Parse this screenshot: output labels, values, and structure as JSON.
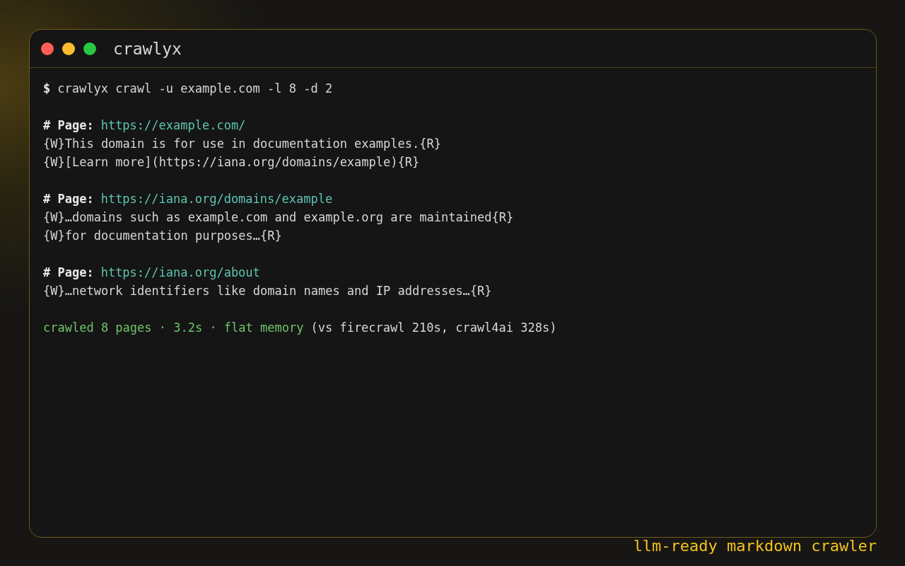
{
  "window": {
    "title": "crawlyx"
  },
  "terminal": {
    "blocks": [
      {
        "lines": [
          {
            "kind": "command",
            "prompt": "$",
            "text": "crawlyx crawl -u example.com -l 8 -d 2"
          }
        ]
      },
      {
        "lines": [
          {
            "kind": "page",
            "label": "# Page:",
            "url": "https://example.com/"
          },
          {
            "kind": "text",
            "text": "{W}This domain is for use in documentation examples.{R}"
          },
          {
            "kind": "text",
            "text": "{W}[Learn more](https://iana.org/domains/example){R}"
          }
        ]
      },
      {
        "lines": [
          {
            "kind": "page",
            "label": "# Page:",
            "url": "https://iana.org/domains/example"
          },
          {
            "kind": "text",
            "text": "{W}…domains such as example.com and example.org are maintained{R}"
          },
          {
            "kind": "text",
            "text": "{W}for documentation purposes…{R}"
          }
        ]
      },
      {
        "lines": [
          {
            "kind": "page",
            "label": "# Page:",
            "url": "https://iana.org/about"
          },
          {
            "kind": "text",
            "text": "{W}…network identifiers like domain names and IP addresses…{R}"
          }
        ]
      },
      {
        "lines": [
          {
            "kind": "summary",
            "highlight": "crawled 8 pages · 3.2s · flat memory",
            "text": "(vs firecrawl 210s, crawl4ai 328s)"
          }
        ]
      }
    ]
  },
  "tagline": "llm-ready markdown crawler"
}
